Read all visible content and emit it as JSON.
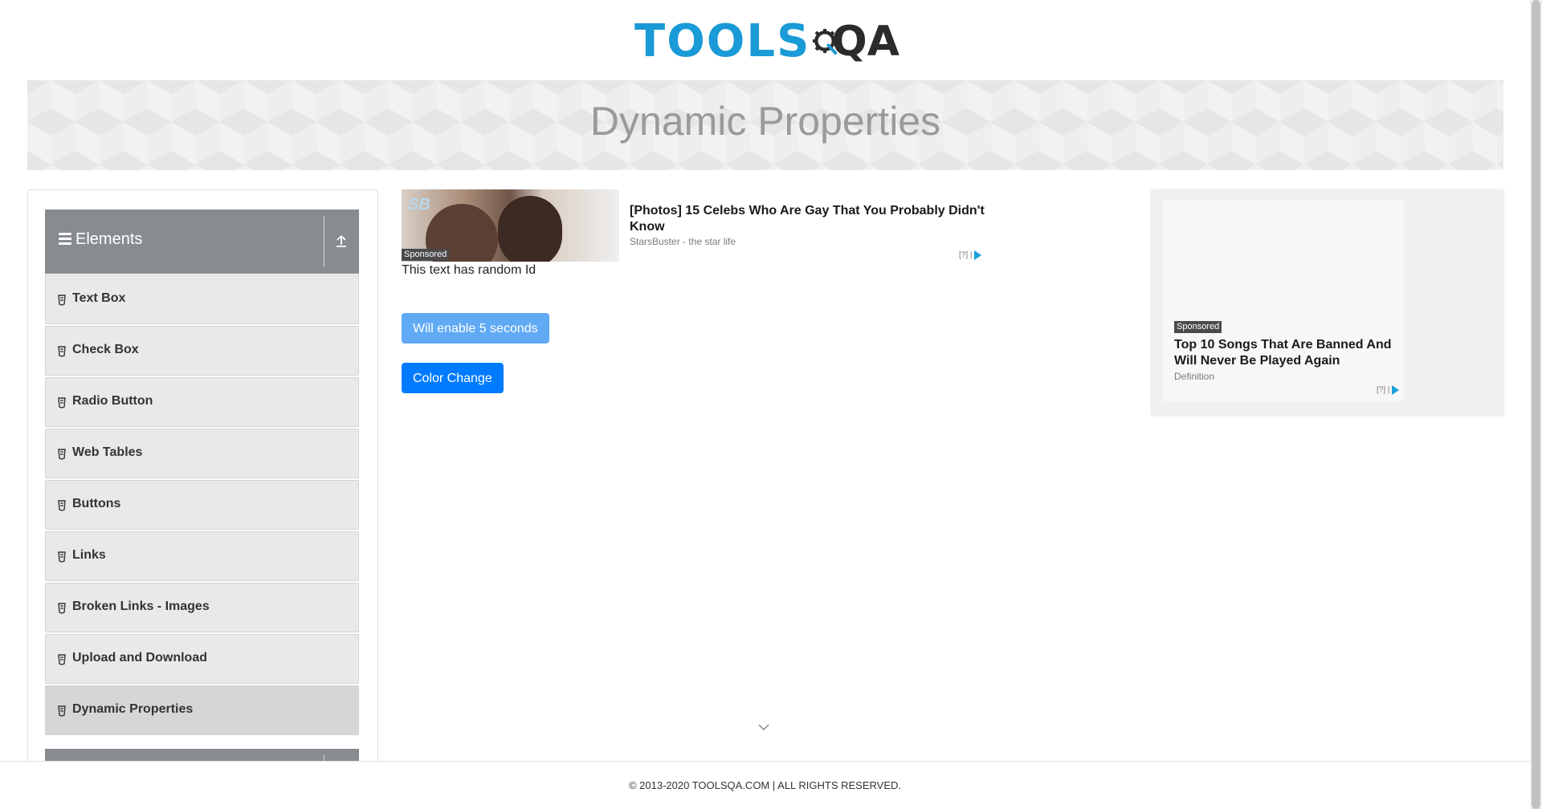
{
  "header": {
    "logo_text": "TOOLS",
    "logo_suffix": "QA"
  },
  "banner": {
    "title": "Dynamic Properties"
  },
  "sidebar": {
    "group_title": "Elements",
    "items": [
      {
        "label": "Text Box"
      },
      {
        "label": "Check Box"
      },
      {
        "label": "Radio Button"
      },
      {
        "label": "Web Tables"
      },
      {
        "label": "Buttons"
      },
      {
        "label": "Links"
      },
      {
        "label": "Broken Links - Images"
      },
      {
        "label": "Upload and Download"
      },
      {
        "label": "Dynamic Properties"
      }
    ],
    "active_item": "Dynamic Properties"
  },
  "ad_top": {
    "image_brand": "SB",
    "sponsored": "Sponsored",
    "headline": "[Photos] 15 Celebs Who Are Gay That You Probably Didn't Know",
    "source": "StarsBuster - the star life",
    "adchoice": "[?]"
  },
  "main": {
    "random_text": "This text has random Id",
    "enable_button": "Will enable 5 seconds",
    "color_button": "Color Change"
  },
  "ad_right": {
    "sponsored": "Sponsored",
    "headline": "Top 10 Songs That Are Banned And Will Never Be Played Again",
    "source": "Definition",
    "adchoice": "[?]"
  },
  "footer": {
    "text": "© 2013-2020 TOOLSQA.COM | ALL RIGHTS RESERVED."
  },
  "colors": {
    "primary": "#007bff",
    "disabled_button": "#60a9f5",
    "logo_blue": "#1a9ad6",
    "sidebar_header": "#888c91"
  }
}
